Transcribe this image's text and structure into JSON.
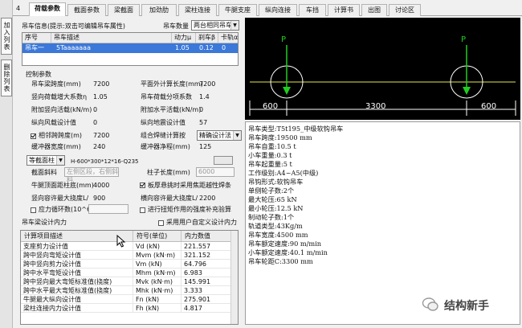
{
  "top_number": "4",
  "side_tabs": [
    "加入列表",
    "删除列表"
  ],
  "tabs": [
    "荷载参数",
    "截面参数",
    "梁截面",
    "加劲肋",
    "梁柱连接",
    "牛腿支座",
    "纵向连接",
    "车挡",
    "计算书",
    "出图",
    "讨论区"
  ],
  "crane_info": {
    "label": "吊车信息(提示:双击可编辑吊车属性)",
    "count_label": "吊车数量",
    "count_value": "两台相同吊车"
  },
  "crane_table": {
    "headers": [
      "序号",
      "吊车描述",
      "动力μ",
      "刹车β",
      "卡轨α"
    ],
    "row": [
      "吊车一",
      "5Taaaaaaa",
      "1.05",
      "0.12",
      "0"
    ]
  },
  "control": {
    "title": "控制参数",
    "left": [
      {
        "label": "吊车梁跨度(mm)",
        "value": "7200"
      },
      {
        "label": "竖向荷载增大系数η",
        "value": "1.05"
      },
      {
        "label": "附加竖向活载(kN/m)",
        "value": "0"
      },
      {
        "label": "纵向风载设计值",
        "value": "0"
      },
      {
        "label": "相邻跨跨度(m)",
        "value": "7200"
      },
      {
        "label": "缓冲器宽度(mm)",
        "value": "240"
      }
    ],
    "right": [
      {
        "label": "平面外计算长度(mm)",
        "value": "7200"
      },
      {
        "label": "吊车荷载分项系数",
        "value": "1.4"
      },
      {
        "label": "附加水平活载(kN/m)",
        "value": "0"
      },
      {
        "label": "纵向地震设计值",
        "value": "57"
      },
      {
        "label": "组合焊缝计算按",
        "value": "精确设计法"
      },
      {
        "label": "缓冲器净程(mm)",
        "value": "125"
      }
    ],
    "section_type": "等截面柱",
    "section_spec": "H-600*300*12*16-Q235",
    "section_edit_label": "截面斜料",
    "section_edit_value": "左侧区段，右侧斜料",
    "col_length_label": "柱子长度(mm)",
    "col_length_value": "6000",
    "gap_label": "牛腿顶面距柱底(mm)",
    "gap_value": "4000",
    "rigid_label": "板厚悬挑时采用焦距越性焊条",
    "span_limit_label": "竖向容许最大挠度L/",
    "span_limit_value": "900",
    "h_limit_label": "横向容许最大挠度L/",
    "h_limit_value": "2200",
    "stress_label": "应力循环数(10^6)",
    "torsion_label": "进行扭矩作用的强度补充验算"
  },
  "internal": {
    "title": "吊车梁设计内力",
    "use_label": "采用用户自定义设计内力",
    "headers": [
      "计算项目描述",
      "符号(单位)",
      "内力数值"
    ],
    "rows": [
      [
        "支座剪力设计值",
        "Vd (kN)",
        "221.557"
      ],
      [
        "跨中竖向弯矩设计值",
        "Mvm (kN·m)",
        "321.152"
      ],
      [
        "跨中竖向剪力设计值",
        "Vm (kN)",
        "64.796"
      ],
      [
        "跨中水平弯矩设计值",
        "Mhm (kN·m)",
        "6.983"
      ],
      [
        "跨中竖向最大弯矩标准值(挠度)",
        "Mvk (kN·m)",
        "145.991"
      ],
      [
        "跨中水平最大弯矩标准值(挠度)",
        "Mhk (kN·m)",
        "3.333"
      ],
      [
        "牛腿最大纵向设计值",
        "Fn (kN)",
        "275.901"
      ],
      [
        "梁柱连接内力设计值",
        "Fh (kN)",
        "4.817"
      ]
    ]
  },
  "diagram": {
    "load_label": "P",
    "spans": [
      "600",
      "3300",
      "600"
    ]
  },
  "crane_props": [
    "吊车类型:T5t195_中级软钩吊车",
    "吊车跨度:19500 mm",
    "吊车自重:10.5 t",
    "小车重量:0.3 t",
    "吊车起重量:5 t",
    "工作级别:A4~A5(中级)",
    "吊钩形式:软钩吊车",
    "单侧轮子数:2个",
    "最大轮压:65 kN",
    "最小轮压:12.5 kN",
    "制动轮子数:1个",
    "轨道类型:43Kg/m",
    "吊车宽度:4500 mm",
    "吊车额定速度:90 m/min",
    "小车额定速度:40.1 m/min",
    "吊车轮距C:3300 mm"
  ],
  "watermark": "结构新手"
}
